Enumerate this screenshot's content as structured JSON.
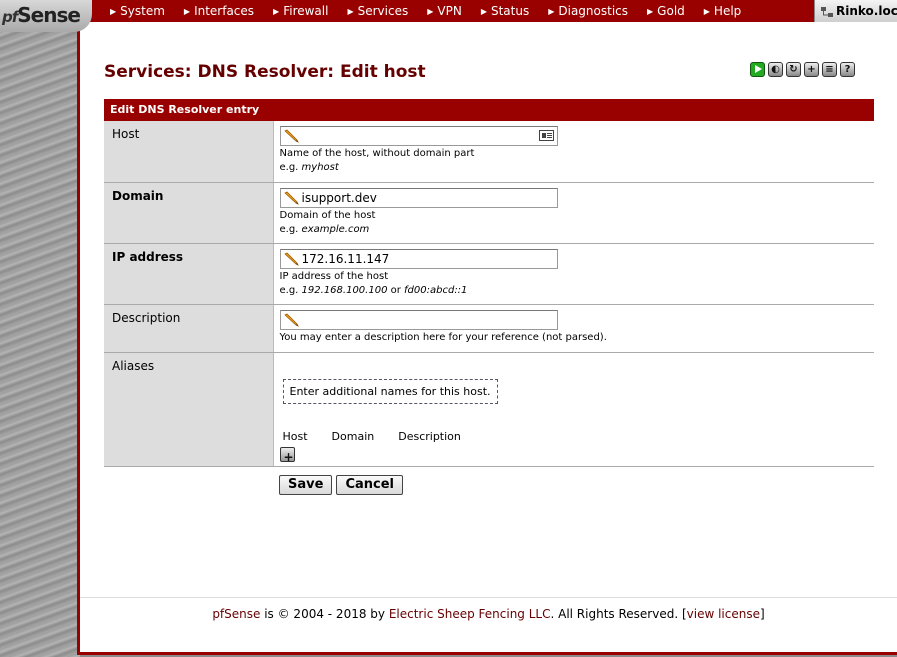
{
  "app": {
    "logo_text": "Sense",
    "logo_prefix": "pf"
  },
  "nav": [
    {
      "label": "System"
    },
    {
      "label": "Interfaces"
    },
    {
      "label": "Firewall"
    },
    {
      "label": "Services"
    },
    {
      "label": "VPN"
    },
    {
      "label": "Status"
    },
    {
      "label": "Diagnostics"
    },
    {
      "label": "Gold"
    },
    {
      "label": "Help"
    }
  ],
  "hostname": "Rinko.loc",
  "page_title": "Services: DNS Resolver: Edit host",
  "toolbar_icons": [
    "play-icon",
    "stop-icon",
    "reload-icon",
    "add-queue-icon",
    "log-icon",
    "help-icon"
  ],
  "form": {
    "header": "Edit DNS Resolver entry",
    "host": {
      "label": "Host",
      "value": "",
      "hint": "Name of the host, without domain part",
      "example_prefix": "e.g. ",
      "example": "myhost"
    },
    "domain": {
      "label": "Domain",
      "value": "isupport.dev",
      "hint": "Domain of the host",
      "example_prefix": "e.g. ",
      "example": "example.com"
    },
    "ip": {
      "label": "IP address",
      "value": "172.16.11.147",
      "hint": "IP address of the host",
      "example_prefix": "e.g. ",
      "example1": "192.168.100.100",
      "or": " or ",
      "example2": "fd00:abcd::1"
    },
    "description": {
      "label": "Description",
      "value": "",
      "hint": "You may enter a description here for your reference (not parsed)."
    },
    "aliases": {
      "label": "Aliases",
      "info": "Enter additional names for this host.",
      "columns": [
        "Host",
        "Domain",
        "Description"
      ]
    },
    "save_label": "Save",
    "cancel_label": "Cancel"
  },
  "footer": {
    "product": "pfSense",
    "text1": " is © 2004 - 2018 by ",
    "company": "Electric Sheep Fencing LLC",
    "text2": ". All Rights Reserved. [",
    "license": "view license",
    "text3": "]"
  },
  "colors": {
    "brand": "#990000",
    "title": "#660000",
    "label_bg": "#dddddd"
  }
}
